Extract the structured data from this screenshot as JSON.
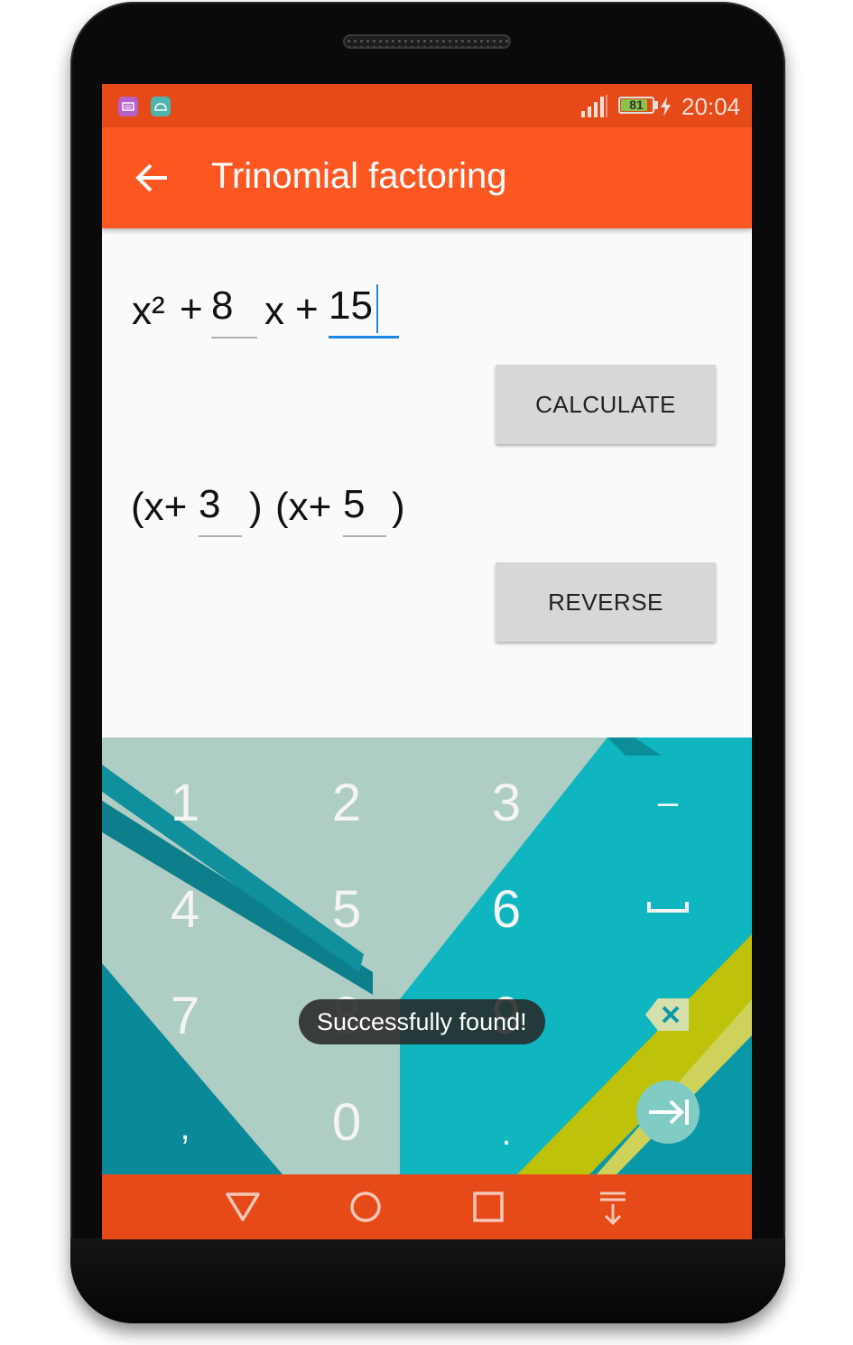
{
  "status_bar": {
    "time": "20:04",
    "battery_level": "81",
    "icons": [
      "keyboard-app-icon",
      "android-app-icon",
      "signal-icon",
      "battery-icon",
      "charging-icon"
    ],
    "color": "#e64a19"
  },
  "toolbar": {
    "title": "Trinomial factoring",
    "back_icon": "arrow-left-icon",
    "color": "#ff5722"
  },
  "equation": {
    "x_squared": "x²",
    "plus1": "+",
    "b_value": "8",
    "x_term": "x",
    "plus2": "+",
    "c_value": "15"
  },
  "buttons": {
    "calculate_label": "CALCULATE",
    "reverse_label": "REVERSE"
  },
  "result": {
    "open1": "(x+",
    "root1": "3",
    "close1": ")",
    "open2": "(x+",
    "root2": "5",
    "close2": ")"
  },
  "keyboard": {
    "keys": [
      "1",
      "2",
      "3",
      "–",
      "4",
      "5",
      "6",
      "␣",
      "7",
      "8",
      "9",
      "⌫",
      ",",
      "0",
      ".",
      "⇥"
    ],
    "row1": [
      "1",
      "2",
      "3",
      "–"
    ],
    "row2": [
      "4",
      "5",
      "6"
    ],
    "row3": [
      "7",
      "8",
      "9"
    ],
    "row4": [
      ",",
      "0",
      "."
    ],
    "space_icon": "space-icon",
    "delete_icon": "backspace-icon",
    "enter_icon": "tab-next-icon"
  },
  "toast": {
    "message": "Successfully found!"
  },
  "nav_bar": {
    "icons": [
      "back-triangle-icon",
      "home-circle-icon",
      "recents-square-icon",
      "notification-pull-icon"
    ],
    "color": "#e64a19"
  }
}
